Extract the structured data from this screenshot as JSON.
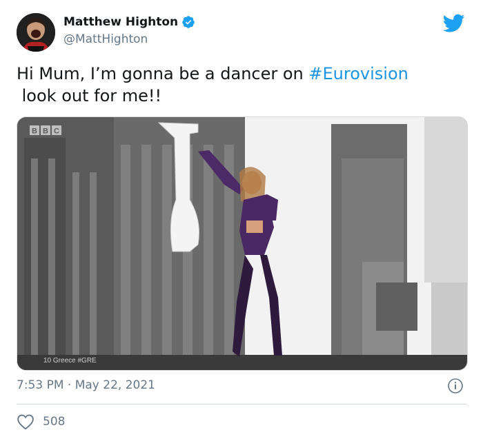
{
  "author": {
    "display_name": "Matthew Highton",
    "handle": "@MattHighton",
    "verified": true
  },
  "tweet": {
    "text_before_hashtag": "Hi Mum, I’m gonna be a dancer on ",
    "hashtag": "#Eurovision",
    "text_line_2": " look out for me!!"
  },
  "media": {
    "channel_logo": "BBC",
    "caption": "10 Greece #GRE"
  },
  "meta": {
    "time": "7:53 PM",
    "separator": " · ",
    "date": "May 22, 2021"
  },
  "engagement": {
    "likes": "508"
  },
  "icons": {
    "brand": "twitter-bird-icon",
    "verified": "verified-badge-icon",
    "info": "info-icon",
    "like": "heart-icon"
  },
  "colors": {
    "brand_blue": "#1da1f2",
    "hashtag_blue": "#1b95e0",
    "secondary_text": "#657786",
    "divider": "#ccd6dd"
  }
}
